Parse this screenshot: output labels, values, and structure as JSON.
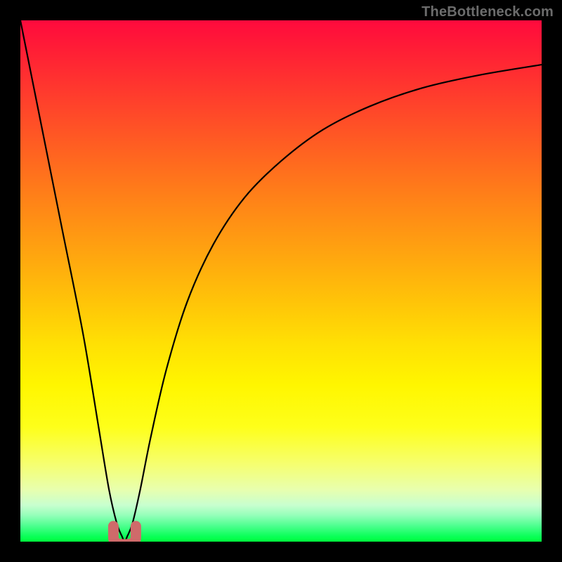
{
  "attribution": "TheBottleneck.com",
  "colors": {
    "frame": "#000000",
    "gradient_top": "#ff0a3d",
    "gradient_bottom": "#00ff3c",
    "curve": "#000000",
    "marker": "#cf6a6a"
  },
  "chart_data": {
    "type": "line",
    "title": "",
    "xlabel": "",
    "ylabel": "",
    "ylim": [
      0,
      100
    ],
    "xlim": [
      0,
      100
    ],
    "series": [
      {
        "name": "bottleneck-curve",
        "x": [
          0,
          4,
          8,
          12,
          15,
          17,
          18.5,
          19.5,
          20,
          20.5,
          21.5,
          23,
          25,
          28,
          32,
          37,
          43,
          50,
          58,
          67,
          77,
          88,
          100
        ],
        "y": [
          100,
          80,
          60,
          40,
          22,
          10,
          3.5,
          1,
          0,
          1,
          3.5,
          10,
          20,
          33,
          46,
          57,
          66,
          73,
          79,
          83.5,
          87,
          89.5,
          91.5
        ]
      }
    ],
    "markers": [
      {
        "name": "min-point",
        "x": 20,
        "y": 0
      }
    ],
    "grid": false,
    "legend": false
  }
}
